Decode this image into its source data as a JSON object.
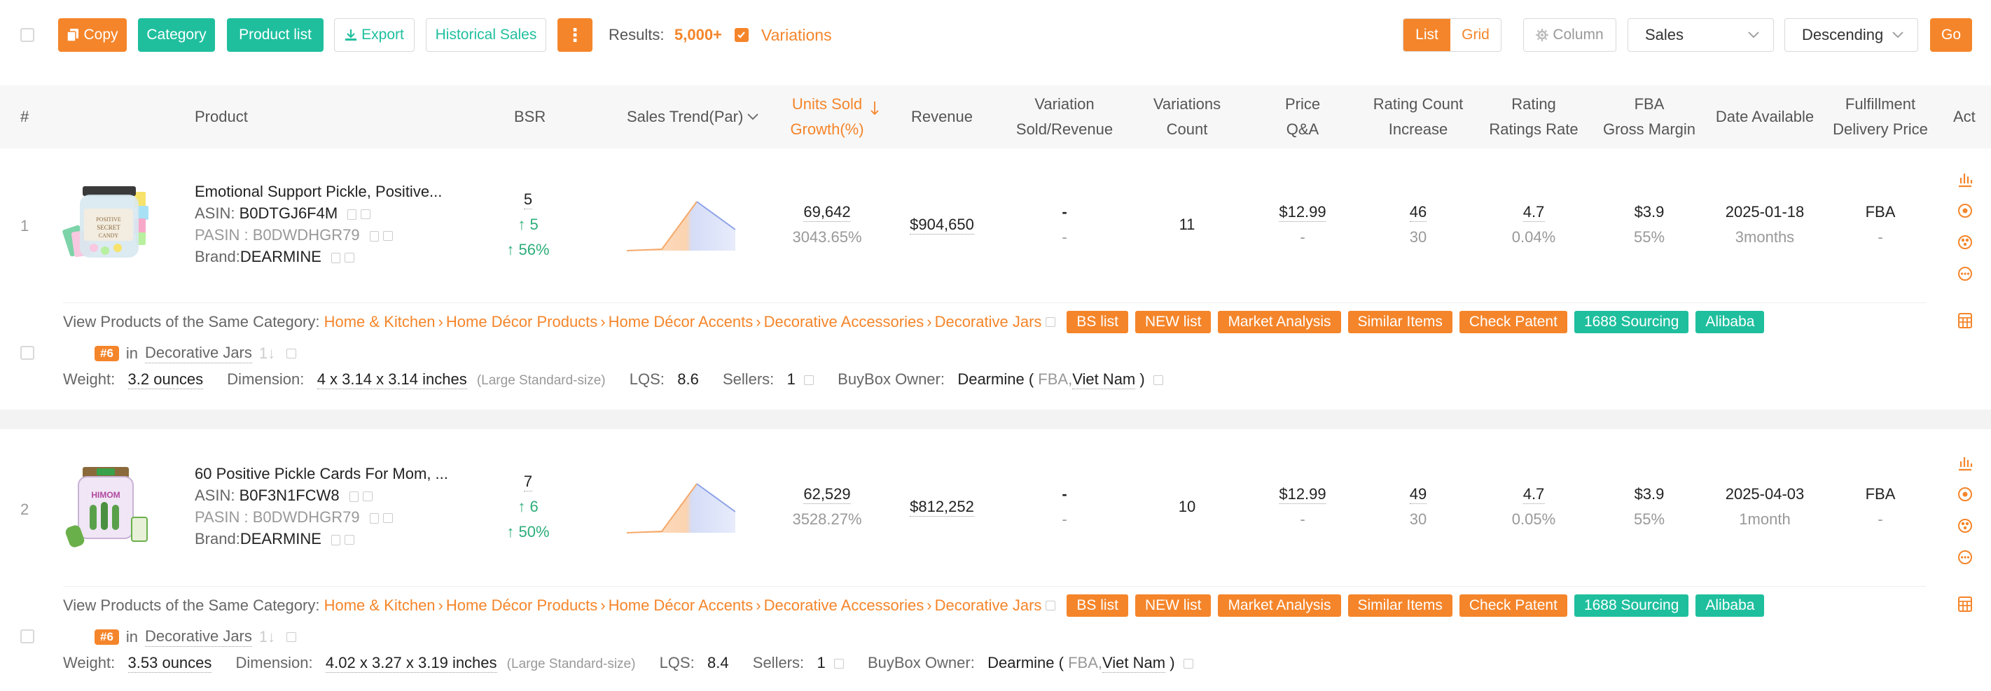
{
  "toolbar": {
    "copy": "Copy",
    "category": "Category",
    "product_list": "Product list",
    "export": "Export",
    "historical_sales": "Historical Sales",
    "more": "⋮",
    "results_label": "Results:",
    "results_value": "5,000+",
    "variations": "Variations",
    "view_list": "List",
    "view_grid": "Grid",
    "column": "Column",
    "sort_field": "Sales",
    "sort_order": "Descending",
    "go": "Go"
  },
  "columns": {
    "num": "#",
    "product": "Product",
    "bsr": "BSR",
    "sales_trend": "Sales Trend(Par)",
    "units_sold_1": "Units Sold",
    "units_sold_2": "Growth(%)",
    "revenue": "Revenue",
    "variation_1": "Variation",
    "variation_2": "Sold/Revenue",
    "variations_count_1": "Variations",
    "variations_count_2": "Count",
    "price_1": "Price",
    "price_2": "Q&A",
    "rating_count_1": "Rating Count",
    "rating_count_2": "Increase",
    "rating_1": "Rating",
    "rating_2": "Ratings Rate",
    "fba_1": "FBA",
    "fba_2": "Gross Margin",
    "date_available": "Date Available",
    "fulfillment_1": "Fulfillment",
    "fulfillment_2": "Delivery Price",
    "action": "Act"
  },
  "labels": {
    "asin": "ASIN:",
    "pasin": "PASIN :",
    "brand": "Brand:",
    "view_same_category": "View Products of the Same Category:",
    "in": "in",
    "weight": "Weight:",
    "dimension": "Dimension:",
    "lqs": "LQS:",
    "sellers": "Sellers:",
    "buybox_owner": "BuyBox Owner:",
    "arrow_up": "↑",
    "dash": "-",
    "sort_glyph": "1↓",
    "chevron": "›"
  },
  "tags": {
    "bs_list": "BS list",
    "new_list": "NEW list",
    "market_analysis": "Market Analysis",
    "similar_items": "Similar Items",
    "check_patent": "Check Patent",
    "sourcing_1688": "1688 Sourcing",
    "alibaba": "Alibaba"
  },
  "rows": [
    {
      "index": "1",
      "title": "Emotional Support Pickle, Positive...",
      "asin": "B0DTGJ6F4M",
      "pasin": "B0DWDHGR79",
      "brand": "DEARMINE",
      "bsr": "5",
      "bsr_change": "5",
      "bsr_pct": "56%",
      "units": "69,642",
      "growth": "3043.65%",
      "revenue": "$904,650",
      "variation_sold": "-",
      "variation_rev": "-",
      "variations_count": "11",
      "price": "$12.99",
      "qa": "-",
      "rating_count": "46",
      "rating_increase": "30",
      "rating": "4.7",
      "ratings_rate": "0.04%",
      "fba": "$3.9",
      "margin": "55%",
      "date": "2025-01-18",
      "age": "3months",
      "fulfillment": "FBA",
      "delivery_price": "-",
      "categories": [
        "Home & Kitchen",
        "Home Décor Products",
        "Home Décor Accents",
        "Decorative Accessories",
        "Decorative Jars"
      ],
      "rank": "#6",
      "rank_category": "Decorative Jars",
      "weight": "3.2 ounces",
      "dimension": "4 x 3.14 x 3.14 inches",
      "size_tier": "(Large Standard-size)",
      "lqs": "8.6",
      "sellers": "1",
      "owner": "Dearmine",
      "owner_type": "FBA,",
      "owner_country": "Viet Nam",
      "paren_open": "(",
      "paren_close": ")"
    },
    {
      "index": "2",
      "title": "60 Positive Pickle Cards For Mom, ...",
      "asin": "B0F3N1FCW8",
      "pasin": "B0DWDHGR79",
      "brand": "DEARMINE",
      "bsr": "7",
      "bsr_change": "6",
      "bsr_pct": "50%",
      "units": "62,529",
      "growth": "3528.27%",
      "revenue": "$812,252",
      "variation_sold": "-",
      "variation_rev": "-",
      "variations_count": "10",
      "price": "$12.99",
      "qa": "-",
      "rating_count": "49",
      "rating_increase": "30",
      "rating": "4.7",
      "ratings_rate": "0.05%",
      "fba": "$3.9",
      "margin": "55%",
      "date": "2025-04-03",
      "age": "1month",
      "fulfillment": "FBA",
      "delivery_price": "-",
      "categories": [
        "Home & Kitchen",
        "Home Décor Products",
        "Home Décor Accents",
        "Decorative Accessories",
        "Decorative Jars"
      ],
      "rank": "#6",
      "rank_category": "Decorative Jars",
      "weight": "3.53 ounces",
      "dimension": "4.02 x 3.27 x 3.19 inches",
      "size_tier": "(Large Standard-size)",
      "lqs": "8.4",
      "sellers": "1",
      "owner": "Dearmine",
      "owner_type": "FBA,",
      "owner_country": "Viet Nam",
      "paren_open": "(",
      "paren_close": ")"
    }
  ],
  "colors": {
    "accent_orange": "#f5852a",
    "accent_teal": "#1fbf9e",
    "green": "#2cae7a"
  }
}
